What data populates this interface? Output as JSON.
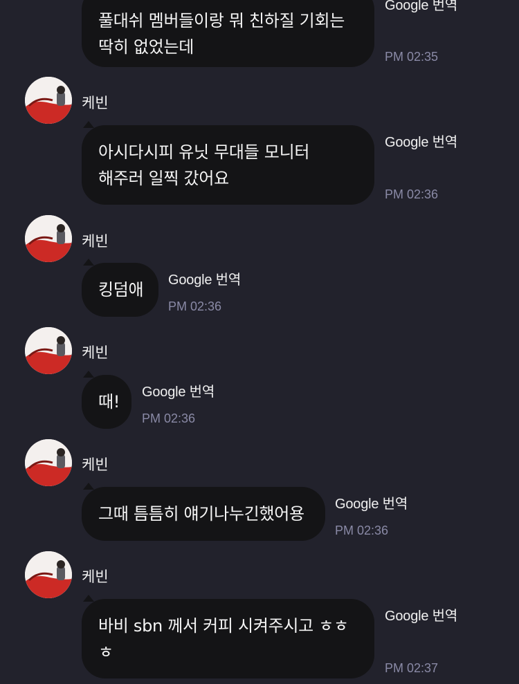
{
  "translate_label": "Google 번역",
  "messages": [
    {
      "sender": "",
      "text": "풀대쉬 멤버들이랑 뭐 친하질 기회는 딱히 없었는데",
      "time": "PM 02:35"
    },
    {
      "sender": "케빈",
      "text": "아시다시피 유닛 무대들 모니터 해주러 일찍 갔어요",
      "time": "PM 02:36"
    },
    {
      "sender": "케빈",
      "text": "킹덤애",
      "time": "PM 02:36"
    },
    {
      "sender": "케빈",
      "text": "때!",
      "time": "PM 02:36"
    },
    {
      "sender": "케빈",
      "text": "그때 틈틈히 얘기나누긴했어용",
      "time": "PM 02:36"
    },
    {
      "sender": "케빈",
      "text": "바비 sbn 께서 커피 시켜주시고 ㅎㅎ ㅎ",
      "time": "PM 02:37"
    }
  ]
}
